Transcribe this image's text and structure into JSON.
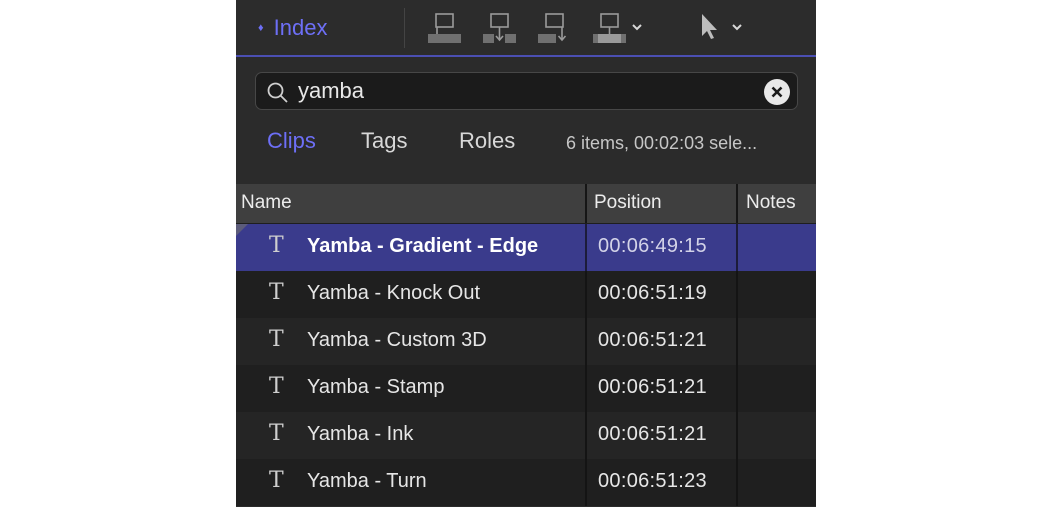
{
  "toolbar": {
    "index_label": "Index",
    "tools": [
      {
        "icon": "connect-clip-icon"
      },
      {
        "icon": "insert-clip-icon"
      },
      {
        "icon": "append-clip-icon"
      },
      {
        "icon": "overwrite-clip-icon"
      },
      {
        "icon": "select-tool-icon"
      }
    ],
    "accent_color": "#6d6ff6"
  },
  "search": {
    "value": "yamba",
    "placeholder": ""
  },
  "tabs": [
    {
      "label": "Clips",
      "active": true
    },
    {
      "label": "Tags",
      "active": false
    },
    {
      "label": "Roles",
      "active": false
    }
  ],
  "summary": "6 items, 00:02:03 sele...",
  "table": {
    "columns": [
      "Name",
      "Position",
      "Notes"
    ],
    "rows": [
      {
        "name": "Yamba - Gradient - Edge",
        "position": "00:06:49:15",
        "notes": "",
        "selected": true
      },
      {
        "name": "Yamba - Knock Out",
        "position": "00:06:51:19",
        "notes": "",
        "selected": false
      },
      {
        "name": "Yamba - Custom 3D",
        "position": "00:06:51:21",
        "notes": "",
        "selected": false
      },
      {
        "name": "Yamba - Stamp",
        "position": "00:06:51:21",
        "notes": "",
        "selected": false
      },
      {
        "name": "Yamba - Ink",
        "position": "00:06:51:21",
        "notes": "",
        "selected": false
      },
      {
        "name": "Yamba - Turn",
        "position": "00:06:51:23",
        "notes": "",
        "selected": false
      }
    ],
    "row_icon": "title-text-icon",
    "row_icon_glyph": "T",
    "selection_color": "#3a3b8c"
  }
}
